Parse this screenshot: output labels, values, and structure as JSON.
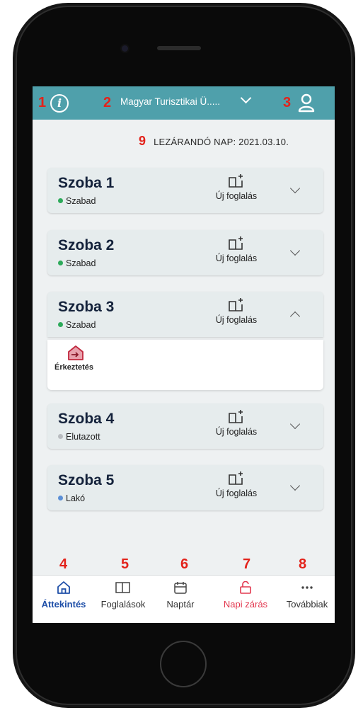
{
  "header": {
    "hotel_name": "Magyar Turisztikai Ü.....",
    "annotations": {
      "info": "1",
      "hotel": "2",
      "user": "3"
    },
    "bg_color": "#4fa0ab"
  },
  "closing_day": {
    "annotation": "9",
    "label": "LEZÁRANDÓ NAP: 2021.03.10."
  },
  "rooms": [
    {
      "title": "Szoba 1",
      "status": "Szabad",
      "status_color": "#2daa5a",
      "action": "Új foglalás",
      "expanded": false
    },
    {
      "title": "Szoba 2",
      "status": "Szabad",
      "status_color": "#2daa5a",
      "action": "Új foglalás",
      "expanded": false
    },
    {
      "title": "Szoba 3",
      "status": "Szabad",
      "status_color": "#2daa5a",
      "action": "Új foglalás",
      "expanded": true
    },
    {
      "title": "Szoba 4",
      "status": "Elutazott",
      "status_color": "#b9bcc0",
      "action": "Új foglalás",
      "expanded": false
    },
    {
      "title": "Szoba 5",
      "status": "Lakó",
      "status_color": "#5b8fd6",
      "action": "Új foglalás",
      "expanded": false
    }
  ],
  "expanded_panel": {
    "action_label": "Érkeztetés",
    "icon": "house-enter-icon"
  },
  "tabs": [
    {
      "num": "4",
      "label": "Áttekintés",
      "icon": "home-icon",
      "active": true
    },
    {
      "num": "5",
      "label": "Foglalások",
      "icon": "book-icon",
      "active": false
    },
    {
      "num": "6",
      "label": "Naptár",
      "icon": "calendar-icon",
      "active": false
    },
    {
      "num": "7",
      "label": "Napi zárás",
      "icon": "unlock-icon",
      "active": false,
      "highlight": true
    },
    {
      "num": "8",
      "label": "Továbbiak",
      "icon": "more-icon",
      "active": false
    }
  ],
  "colors": {
    "accent": "#1f4fa8",
    "highlight": "#e2384f",
    "annotation": "#e3231b"
  }
}
